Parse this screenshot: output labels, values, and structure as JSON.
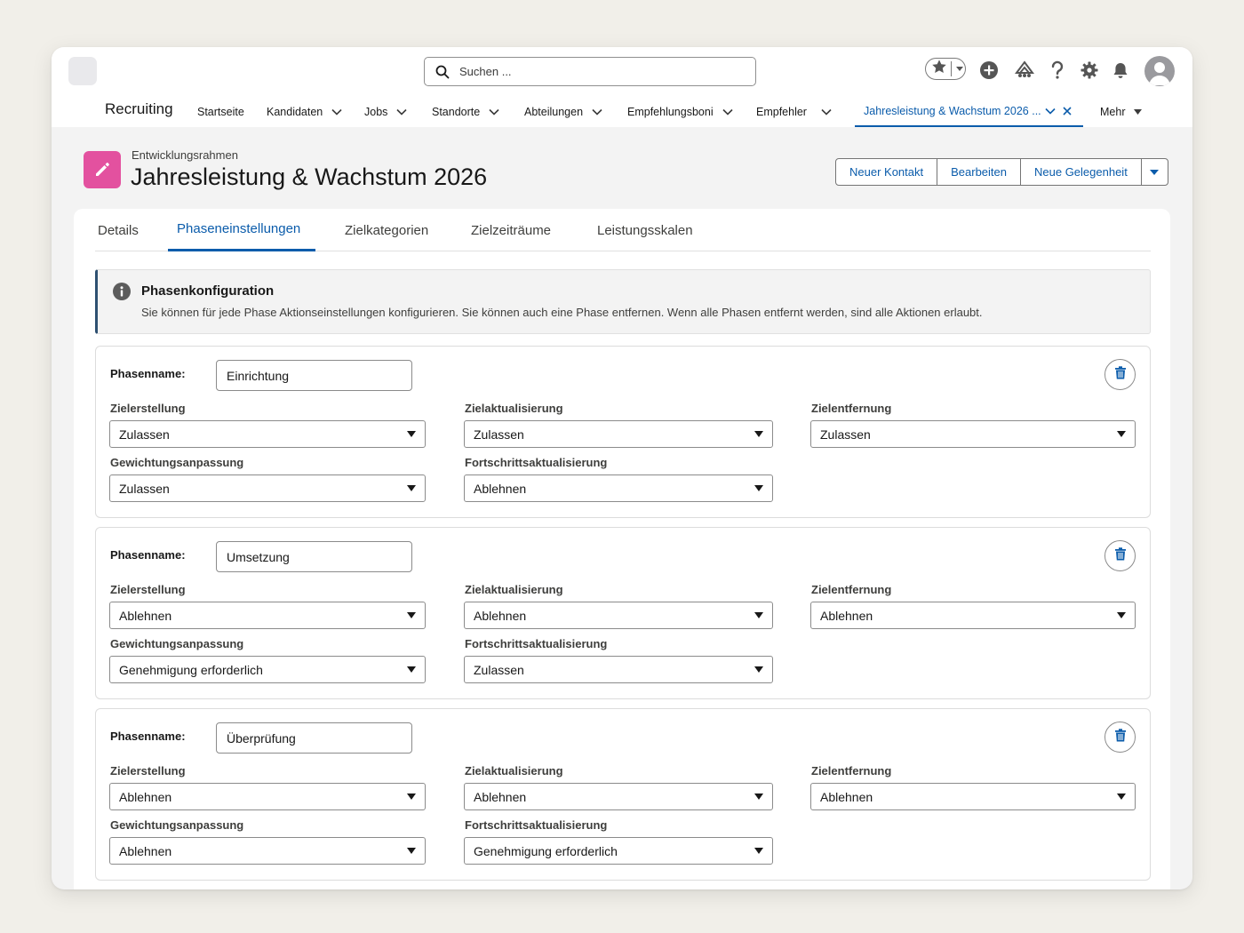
{
  "header": {
    "search_placeholder": "Suchen ..."
  },
  "nav": {
    "app_name": "Recruiting",
    "items": [
      {
        "label": "Startseite"
      },
      {
        "label": "Kandidaten"
      },
      {
        "label": "Jobs"
      },
      {
        "label": "Standorte"
      },
      {
        "label": "Abteilungen"
      },
      {
        "label": "Empfehlungsboni"
      },
      {
        "label": "Empfehler"
      },
      {
        "label": "Jahresleistung & Wachstum 2026 ..."
      },
      {
        "label": "Mehr"
      }
    ]
  },
  "record": {
    "type": "Entwicklungsrahmen",
    "title": "Jahresleistung & Wachstum 2026",
    "actions": [
      "Neuer Kontakt",
      "Bearbeiten",
      "Neue Gelegenheit"
    ]
  },
  "tabs": [
    "Details",
    "Phaseneinstellungen",
    "Zielkategorien",
    "Zielzeiträume",
    "Leistungsskalen"
  ],
  "info": {
    "title": "Phasenkonfiguration",
    "text": "Sie können für jede Phase Aktionseinstellungen konfigurieren. Sie können auch eine Phase entfernen. Wenn alle Phasen entfernt werden, sind alle Aktionen erlaubt."
  },
  "phase_name_label": "Phasenname:",
  "field_labels": {
    "goal_creation": "Zielerstellung",
    "goal_update": "Zielaktualisierung",
    "goal_removal": "Zielentfernung",
    "weight_adjustment": "Gewichtungsanpassung",
    "progress_update": "Fortschrittsaktualisierung"
  },
  "phases": [
    {
      "name": "Einrichtung",
      "goal_creation": "Zulassen",
      "goal_update": "Zulassen",
      "goal_removal": "Zulassen",
      "weight_adjustment": "Zulassen",
      "progress_update": "Ablehnen"
    },
    {
      "name": "Umsetzung",
      "goal_creation": "Ablehnen",
      "goal_update": "Ablehnen",
      "goal_removal": "Ablehnen",
      "weight_adjustment": "Genehmigung erforderlich",
      "progress_update": "Zulassen"
    },
    {
      "name": "Überprüfung",
      "goal_creation": "Ablehnen",
      "goal_update": "Ablehnen",
      "goal_removal": "Ablehnen",
      "weight_adjustment": "Ablehnen",
      "progress_update": "Genehmigung erforderlich"
    }
  ]
}
